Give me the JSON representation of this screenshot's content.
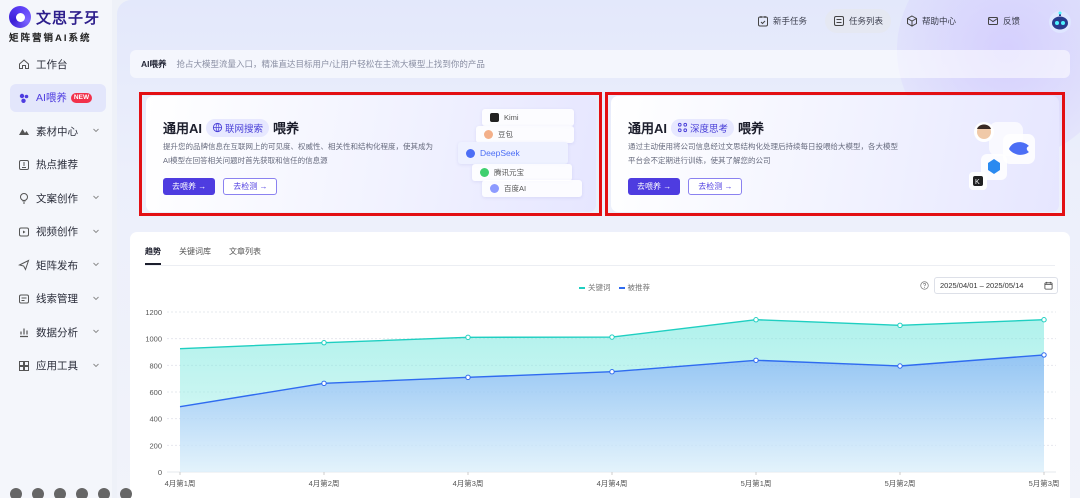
{
  "brand": {
    "title": "文思子牙",
    "subtitle": "矩阵营销AI系统"
  },
  "sidebar": {
    "items": [
      {
        "label": "工作台",
        "icon": "home-icon",
        "active": false,
        "arrow": false
      },
      {
        "label": "AI喂养",
        "icon": "ai-feed-icon",
        "active": true,
        "arrow": false,
        "badge": "NEW"
      },
      {
        "label": "素材中心",
        "icon": "material-icon",
        "active": false,
        "arrow": true
      },
      {
        "label": "热点推荐",
        "icon": "hot-icon",
        "active": false,
        "arrow": false
      },
      {
        "label": "文案创作",
        "icon": "bulb-icon",
        "active": false,
        "arrow": true
      },
      {
        "label": "视频创作",
        "icon": "video-icon",
        "active": false,
        "arrow": true
      },
      {
        "label": "矩阵发布",
        "icon": "send-icon",
        "active": false,
        "arrow": true
      },
      {
        "label": "线索管理",
        "icon": "leads-icon",
        "active": false,
        "arrow": true
      },
      {
        "label": "数据分析",
        "icon": "chart-icon",
        "active": false,
        "arrow": true
      },
      {
        "label": "应用工具",
        "icon": "tools-icon",
        "active": false,
        "arrow": true
      }
    ]
  },
  "topbar": {
    "items": [
      {
        "label": "新手任务",
        "icon": "task-icon"
      },
      {
        "label": "任务列表",
        "icon": "list-icon",
        "active": true
      },
      {
        "label": "帮助中心",
        "icon": "box-icon"
      },
      {
        "label": "反馈",
        "icon": "mail-icon"
      }
    ]
  },
  "banner": {
    "tag": "AI喂养",
    "desc": "抢占大模型流量入口，精准直达目标用户/让用户轻松在主流大模型上找到你的产品"
  },
  "cards": [
    {
      "title_prefix": "通用AI",
      "pill": "联网搜索",
      "title_suffix": "喂养",
      "desc": "提升您的品牌信息在互联网上的可见度、权威性、相关性和结构化程度，使其成为AI模型在回答相关问题时首先获取和信任的信息源",
      "primary": "去喂养 →",
      "secondary": "去检测 →",
      "models": [
        "Kimi",
        "豆包",
        "DeepSeek",
        "腾讯元宝",
        "百度AI"
      ]
    },
    {
      "title_prefix": "通用AI",
      "pill": "深度思考",
      "title_suffix": "喂养",
      "desc": "通过主动使用将公司信息经过文思结构化处理后持续每日投喂给大模型，各大模型平台会不定期进行训练，使其了解您的公司",
      "primary": "去喂养 →",
      "secondary": "去检测 →"
    }
  ],
  "panel": {
    "tabs": [
      "趋势",
      "关键词库",
      "文章列表"
    ],
    "active_tab": 0,
    "date_range": "2025/04/01 – 2025/05/14"
  },
  "colors": {
    "accent": "#4e3ce0",
    "series1": "#1fcfc1",
    "series2": "#2f6bf0",
    "highlight": "#e30f13"
  },
  "chart_data": {
    "type": "area",
    "categories": [
      "4月第1周",
      "4月第2周",
      "4月第3周",
      "4月第4周",
      "5月第1周",
      "5月第2周",
      "5月第3周"
    ],
    "series": [
      {
        "name": "关键词",
        "values": [
          925,
          970,
          1010,
          1012,
          1142,
          1100,
          1142
        ],
        "color": "#1fcfc1"
      },
      {
        "name": "被推荐",
        "values": [
          490,
          665,
          710,
          752,
          838,
          795,
          878
        ],
        "color": "#2f6bf0"
      }
    ],
    "ylim": [
      0,
      1200
    ],
    "yticks": [
      0,
      200,
      400,
      600,
      800,
      1000,
      1200
    ],
    "grid": true,
    "legend": "top-center"
  }
}
